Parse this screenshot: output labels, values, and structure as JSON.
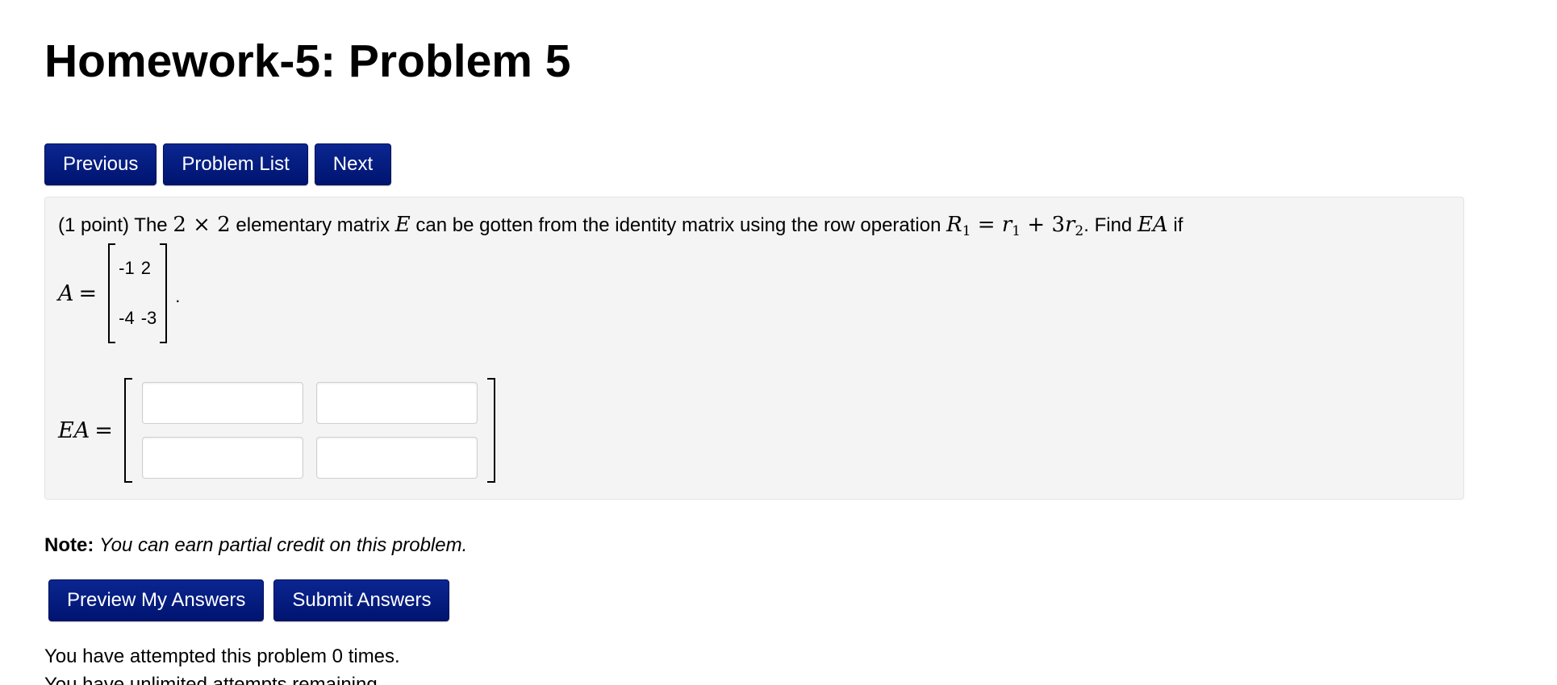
{
  "header": {
    "title": "Homework-5: Problem 5"
  },
  "nav": {
    "previous_label": "Previous",
    "problem_list_label": "Problem List",
    "next_label": "Next"
  },
  "problem": {
    "points": "(1 point) The ",
    "size_expr": "2 × 2",
    "text_1": " elementary matrix ",
    "matrix_symbol": "E",
    "text_2": " can be gotten from the identity matrix using the row operation ",
    "row_op_R": "R",
    "row_op_R_sub": "1",
    "row_op_eq": " = ",
    "row_op_r1": "r",
    "row_op_r1_sub": "1",
    "row_op_plus": " + 3",
    "row_op_r2": "r",
    "row_op_r2_sub": "2",
    "text_3": ". Find ",
    "product_symbol": "EA",
    "text_4": " if",
    "matrix_A_label": "A",
    "equals": "=",
    "matrix_A": [
      [
        "-1",
        "2"
      ],
      [
        "-4",
        "-3"
      ]
    ],
    "period": ".",
    "answer_label": "EA",
    "answer_values": [
      [
        "",
        ""
      ],
      [
        "",
        ""
      ]
    ]
  },
  "note": {
    "label": "Note:",
    "text": "You can earn partial credit on this problem."
  },
  "actions": {
    "preview_label": "Preview My Answers",
    "submit_label": "Submit Answers"
  },
  "attempts": {
    "line_1": "You have attempted this problem 0 times.",
    "line_2": "You have unlimited attempts remaining."
  },
  "colors": {
    "button_bg": "#001a80",
    "problem_bg": "#f4f4f4"
  }
}
